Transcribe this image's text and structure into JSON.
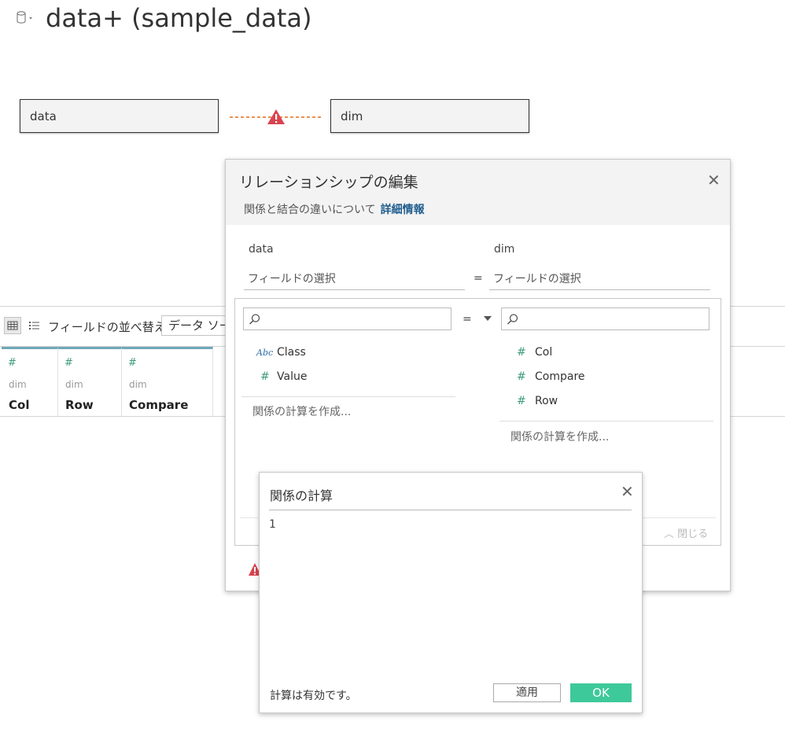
{
  "header": {
    "title": "data+ (sample_data)",
    "datasource_icon": "database-icon"
  },
  "canvas": {
    "left_table": "data",
    "right_table": "dim",
    "relationship_icon": "warning-icon"
  },
  "grid_toolbar": {
    "sort_label": "フィールドの並べ替え",
    "sort_value": "データ ソース順"
  },
  "grid_columns": [
    {
      "type_icon": "#",
      "source": "dim",
      "name": "Col"
    },
    {
      "type_icon": "#",
      "source": "dim",
      "name": "Row"
    },
    {
      "type_icon": "#",
      "source": "dim",
      "name": "Compare"
    }
  ],
  "relationship_dialog": {
    "title": "リレーションシップの編集",
    "subtitle": "関係と結合の違いについて",
    "link": "詳細情報",
    "left_table": "data",
    "right_table": "dim",
    "left_field_placeholder": "フィールドの選択",
    "right_field_placeholder": "フィールドの選択",
    "operator": "=",
    "left_fields": [
      {
        "type": "Abc",
        "name": "Class"
      },
      {
        "type": "#",
        "name": "Value"
      }
    ],
    "right_fields": [
      {
        "type": "#",
        "name": "Col"
      },
      {
        "type": "#",
        "name": "Compare"
      },
      {
        "type": "#",
        "name": "Row"
      }
    ],
    "left_create_calc": "関係の計算を作成...",
    "right_create_calc": "関係の計算を作成...",
    "close_label": "閉じる"
  },
  "calc_dialog": {
    "title": "関係の計算",
    "expression": "1",
    "status": "計算は有効です。",
    "apply_label": "適用",
    "ok_label": "OK"
  },
  "colors": {
    "ok_button": "#3ec99a",
    "warning": "#d9434f",
    "link": "#1f5d8e",
    "relationship_line": "#e8803a",
    "column_accent": "#6fa8b8",
    "number_icon": "#3f9a7f"
  }
}
